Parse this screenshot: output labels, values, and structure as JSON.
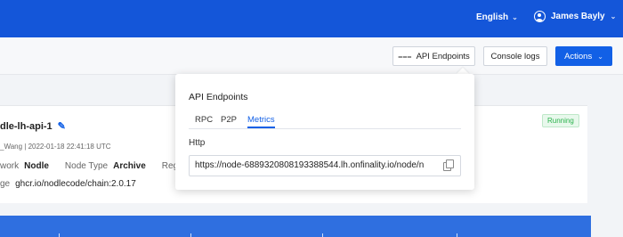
{
  "topbar": {
    "language": "English",
    "user_name": "James Bayly"
  },
  "toolbar": {
    "api_endpoints_label": "API Endpoints",
    "console_logs_label": "Console logs",
    "actions_label": "Actions"
  },
  "node": {
    "name": "dle-lh-api-1",
    "meta": "_Wang | 2022-01-18 22:41:18 UTC",
    "status": "Running",
    "network_label": "work",
    "network_value": "Nodle",
    "node_type_label": "Node Type",
    "node_type_value": "Archive",
    "region_label": "Regi",
    "image_label": "ge",
    "image_value": "ghcr.io/nodlecode/chain:2.0.17"
  },
  "popover": {
    "title": "API Endpoints",
    "tabs": [
      "RPC",
      "P2P",
      "Metrics"
    ],
    "active_tab": "Metrics",
    "http_label": "Http",
    "http_url": "https://node-6889320808193388544.lh.onfinality.io/node/n"
  },
  "colors": {
    "brand_blue": "#1456d9",
    "accent_blue": "#1260e6",
    "running_green": "#2bb24c"
  }
}
